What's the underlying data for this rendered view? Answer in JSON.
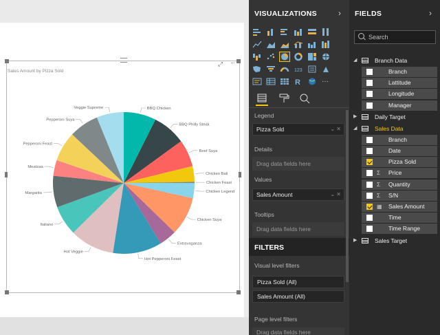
{
  "visual": {
    "title": "Sales Amount by Pizza Sold"
  },
  "chart_data": {
    "type": "pie",
    "title": "Sales Amount by Pizza Sold",
    "slices": [
      {
        "label": "BBQ Chicken",
        "value": 7.4,
        "color": "#01B8AA"
      },
      {
        "label": "BBQ Philly Steak",
        "value": 7.6,
        "color": "#374649"
      },
      {
        "label": "Beef Suya",
        "value": 6.2,
        "color": "#FD625E"
      },
      {
        "label": "Chicken Bali",
        "value": 3.6,
        "color": "#F2C80F"
      },
      {
        "label": "Chicken Feast",
        "value": 0.2,
        "color": "#5F6B6D"
      },
      {
        "label": "Chicken Legend",
        "value": 3.5,
        "color": "#8AD4EB"
      },
      {
        "label": "Chicken Suya",
        "value": 8.8,
        "color": "#FE9666"
      },
      {
        "label": "Extravaganza",
        "value": 4.0,
        "color": "#A66999"
      },
      {
        "label": "Hot Pepperoni Feast",
        "value": 11.2,
        "color": "#3599B8"
      },
      {
        "label": "Hot Veggie",
        "value": 10.2,
        "color": "#DFBFBF"
      },
      {
        "label": "Italiano",
        "value": 6.8,
        "color": "#4AC5BB"
      },
      {
        "label": "Margarita",
        "value": 7.2,
        "color": "#5F6B6D"
      },
      {
        "label": "Meatzaa",
        "value": 3.6,
        "color": "#FB8281"
      },
      {
        "label": "Pepperoni Feast",
        "value": 6.8,
        "color": "#F4D25A"
      },
      {
        "label": "Pepperoni Suya",
        "value": 6.8,
        "color": "#7F898A"
      },
      {
        "label": "Veggie Supreme",
        "value": 6.2,
        "color": "#A4DDEE"
      }
    ]
  },
  "visualizations": {
    "title": "VISUALIZATIONS",
    "wells": {
      "legend_label": "Legend",
      "legend_value": "Pizza Sold",
      "details_label": "Details",
      "details_placeholder": "Drag data fields here",
      "values_label": "Values",
      "values_value": "Sales Amount",
      "tooltips_label": "Tooltips",
      "tooltips_placeholder": "Drag data fields here"
    }
  },
  "filters": {
    "title": "FILTERS",
    "visual_level_label": "Visual level filters",
    "visual_level_items": [
      "Pizza Sold  (All)",
      "Sales Amount  (All)"
    ],
    "page_level_label": "Page level filters",
    "page_level_placeholder": "Drag data fields here"
  },
  "fields": {
    "title": "FIELDS",
    "search_placeholder": "Search",
    "tables": [
      {
        "name": "Branch Data",
        "expanded": true,
        "fields": [
          {
            "name": "Branch",
            "sigma": false,
            "checked": false
          },
          {
            "name": "Lattitude",
            "sigma": false,
            "checked": false
          },
          {
            "name": "Longitude",
            "sigma": false,
            "checked": false
          },
          {
            "name": "Manager",
            "sigma": false,
            "checked": false
          }
        ]
      },
      {
        "name": "Daily Target",
        "expanded": false,
        "fields": []
      },
      {
        "name": "Sales Data",
        "expanded": true,
        "highlight": true,
        "fields": [
          {
            "name": "Branch",
            "sigma": false,
            "checked": false
          },
          {
            "name": "Date",
            "sigma": false,
            "checked": false
          },
          {
            "name": "Pizza Sold",
            "sigma": false,
            "checked": true
          },
          {
            "name": "Price",
            "sigma": true,
            "checked": false
          },
          {
            "name": "Quantity",
            "sigma": true,
            "checked": false
          },
          {
            "name": "S/N",
            "sigma": true,
            "checked": false
          },
          {
            "name": "Sales Amount",
            "sigma": false,
            "calc": true,
            "checked": true
          },
          {
            "name": "Time",
            "sigma": false,
            "checked": false
          },
          {
            "name": "Time Range",
            "sigma": false,
            "checked": false
          }
        ]
      },
      {
        "name": "Sales Target",
        "expanded": false,
        "fields": []
      }
    ]
  },
  "colors": {
    "accent": "#f2c811",
    "pane_dark": "#343434",
    "fields_bg": "#2a2a2a"
  }
}
